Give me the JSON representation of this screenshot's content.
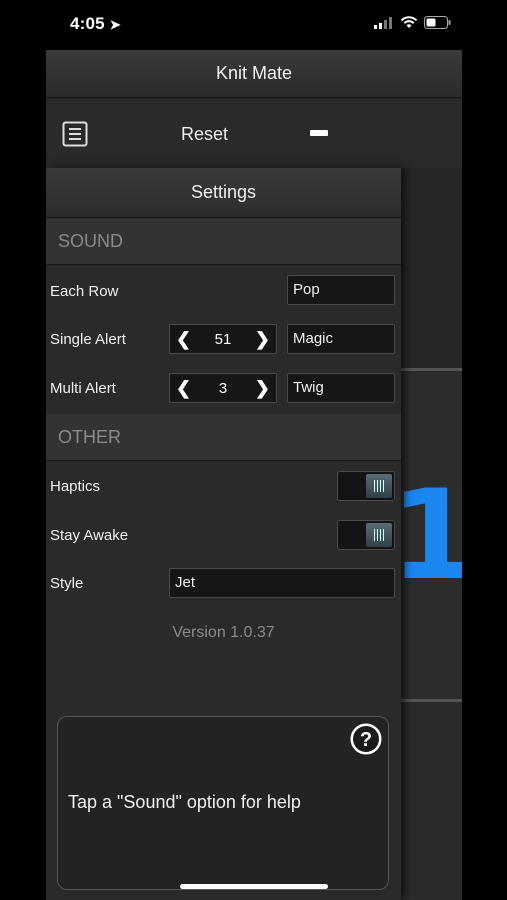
{
  "status_bar": {
    "time": "4:05"
  },
  "app": {
    "title": "Knit Mate",
    "reset_label": "Reset",
    "counter_value": "1",
    "accent": "#1a86f0"
  },
  "settings": {
    "title": "Settings",
    "sound_section": "SOUND",
    "other_section": "OTHER",
    "each_row": {
      "label": "Each Row",
      "value": "Pop"
    },
    "single_alert": {
      "label": "Single Alert",
      "count": "51",
      "sound": "Magic"
    },
    "multi_alert": {
      "label": "Multi Alert",
      "count": "3",
      "sound": "Twig"
    },
    "haptics": {
      "label": "Haptics",
      "on": true
    },
    "stay_awake": {
      "label": "Stay Awake",
      "on": true
    },
    "style": {
      "label": "Style",
      "value": "Jet"
    },
    "version": "Version 1.0.37",
    "help_text": "Tap a \"Sound\" option for help",
    "help_icon": "question-circle-icon"
  }
}
